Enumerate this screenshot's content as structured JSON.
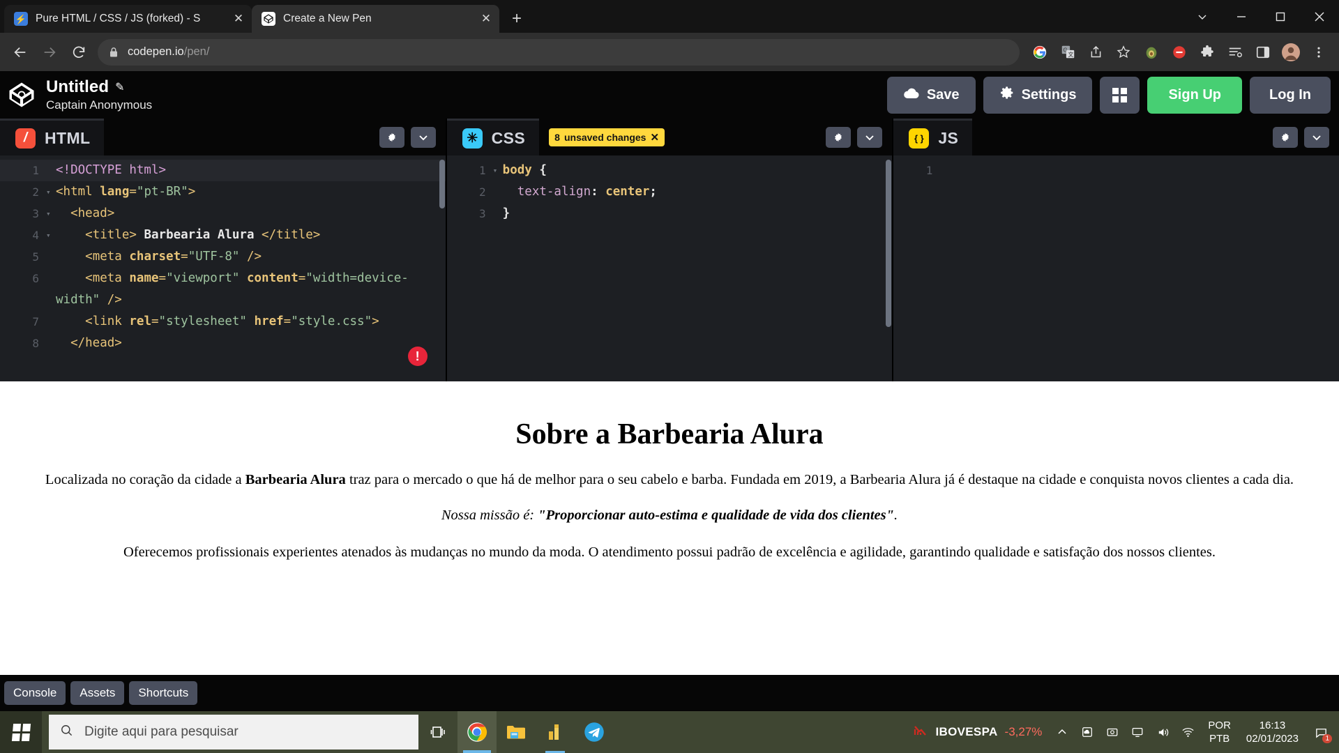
{
  "browser": {
    "tabs": [
      {
        "title": "Pure HTML / CSS / JS (forked) - S",
        "favicon": "codesandbox-bolt-icon",
        "active": false
      },
      {
        "title": "Create a New Pen",
        "favicon": "codepen-icon",
        "active": true
      }
    ],
    "new_tab_label": "+",
    "window_controls": {
      "minimize": "minimize-icon",
      "maximize": "maximize-icon",
      "close": "close-icon",
      "caret": "chevron-down-icon"
    },
    "nav": {
      "back": "back-arrow-icon",
      "forward": "forward-arrow-icon",
      "reload": "reload-icon"
    },
    "omnibox": {
      "lock": "lock-icon",
      "domain": "codepen.io",
      "path": "/pen/"
    },
    "toolbar_icons": [
      "google-icon",
      "google-translate-icon",
      "share-icon",
      "bookmark-star-icon",
      "avocado-extension-icon",
      "adblock-extension-icon",
      "puzzle-extensions-icon",
      "reading-list-icon",
      "side-panel-icon",
      "profile-avatar-icon",
      "chrome-menu-icon"
    ]
  },
  "codepen": {
    "header": {
      "logo": "codepen-logo-icon",
      "pen_title": "Untitled",
      "pencil": "pencil-icon",
      "author": "Captain Anonymous",
      "save_label": "Save",
      "save_icon": "cloud-icon",
      "settings_label": "Settings",
      "settings_icon": "gear-icon",
      "layout_icon": "layout-grid-icon",
      "signup_label": "Sign Up",
      "login_label": "Log In",
      "signup_color": "#47cf73",
      "button_color": "#4a4f5e"
    },
    "editors": [
      {
        "id": "html",
        "label": "HTML",
        "chip": "html-icon",
        "chip_color": "#f5503b",
        "badge": null,
        "settings_icon": "gear-icon",
        "chevron_icon": "chevron-down-icon",
        "error_badge": "!",
        "lines": [
          {
            "num": "1",
            "fold": "",
            "highlight": true,
            "tokens": [
              {
                "t": "doct",
                "s": "<!DOCTYPE html>"
              }
            ]
          },
          {
            "num": "2",
            "fold": "▾",
            "highlight": false,
            "tokens": [
              {
                "t": "tag",
                "s": "<html "
              },
              {
                "t": "attr",
                "s": "lang"
              },
              {
                "t": "tag",
                "s": "="
              },
              {
                "t": "str",
                "s": "\"pt-BR\""
              },
              {
                "t": "tag",
                "s": ">"
              }
            ]
          },
          {
            "num": "3",
            "fold": "▾",
            "highlight": false,
            "tokens": [
              {
                "t": "plain",
                "s": "  "
              },
              {
                "t": "tag",
                "s": "<head>"
              }
            ]
          },
          {
            "num": "4",
            "fold": "▾",
            "highlight": false,
            "tokens": [
              {
                "t": "plain",
                "s": "    "
              },
              {
                "t": "tag",
                "s": "<title>"
              },
              {
                "t": "txt",
                "s": " Barbearia Alura "
              },
              {
                "t": "tag",
                "s": "</title>"
              }
            ]
          },
          {
            "num": "5",
            "fold": "",
            "highlight": false,
            "tokens": [
              {
                "t": "plain",
                "s": "    "
              },
              {
                "t": "tag",
                "s": "<meta "
              },
              {
                "t": "attr",
                "s": "charset"
              },
              {
                "t": "tag",
                "s": "="
              },
              {
                "t": "str",
                "s": "\"UTF-8\""
              },
              {
                "t": "tag",
                "s": " />"
              }
            ]
          },
          {
            "num": "6",
            "fold": "",
            "highlight": false,
            "tokens": [
              {
                "t": "plain",
                "s": "    "
              },
              {
                "t": "tag",
                "s": "<meta "
              },
              {
                "t": "attr",
                "s": "name"
              },
              {
                "t": "tag",
                "s": "="
              },
              {
                "t": "str",
                "s": "\"viewport\""
              },
              {
                "t": "plain",
                "s": " "
              },
              {
                "t": "attr",
                "s": "content"
              },
              {
                "t": "tag",
                "s": "="
              },
              {
                "t": "str",
                "s": "\"width=device-width\""
              },
              {
                "t": "tag",
                "s": " />"
              }
            ]
          },
          {
            "num": "7",
            "fold": "",
            "highlight": false,
            "tokens": [
              {
                "t": "plain",
                "s": "    "
              },
              {
                "t": "tag",
                "s": "<link "
              },
              {
                "t": "attr",
                "s": "rel"
              },
              {
                "t": "tag",
                "s": "="
              },
              {
                "t": "str",
                "s": "\"stylesheet\""
              },
              {
                "t": "plain",
                "s": " "
              },
              {
                "t": "attr",
                "s": "href"
              },
              {
                "t": "tag",
                "s": "="
              },
              {
                "t": "str",
                "s": "\"style.css\""
              },
              {
                "t": "tag",
                "s": ">"
              }
            ]
          },
          {
            "num": "8",
            "fold": "",
            "highlight": false,
            "tokens": [
              {
                "t": "plain",
                "s": "  "
              },
              {
                "t": "tag",
                "s": "</head>"
              }
            ]
          }
        ]
      },
      {
        "id": "css",
        "label": "CSS",
        "chip": "css-icon",
        "chip_color": "#3acaf9",
        "badge": {
          "count": "8",
          "text": "unsaved changes",
          "close": "✕",
          "color": "#ffd83d"
        },
        "settings_icon": "gear-icon",
        "chevron_icon": "chevron-down-icon",
        "error_badge": null,
        "lines": [
          {
            "num": "1",
            "fold": "▾",
            "highlight": false,
            "tokens": [
              {
                "t": "sel",
                "s": "body"
              },
              {
                "t": "plain",
                "s": " "
              },
              {
                "t": "brace",
                "s": "{"
              }
            ]
          },
          {
            "num": "2",
            "fold": "",
            "highlight": false,
            "tokens": [
              {
                "t": "plain",
                "s": "  "
              },
              {
                "t": "prop",
                "s": "text-align"
              },
              {
                "t": "brace",
                "s": ":"
              },
              {
                "t": "plain",
                "s": " "
              },
              {
                "t": "val",
                "s": "center"
              },
              {
                "t": "brace",
                "s": ";"
              }
            ]
          },
          {
            "num": "3",
            "fold": "",
            "highlight": false,
            "tokens": [
              {
                "t": "brace",
                "s": "}"
              }
            ]
          }
        ]
      },
      {
        "id": "js",
        "label": "JS",
        "chip": "js-icon",
        "chip_color": "#ffd500",
        "badge": null,
        "settings_icon": "gear-icon",
        "chevron_icon": "chevron-down-icon",
        "error_badge": null,
        "lines": [
          {
            "num": "1",
            "fold": "",
            "highlight": false,
            "tokens": []
          }
        ]
      }
    ],
    "preview": {
      "heading": "Sobre a Barbearia Alura",
      "paragraph_1_pre": "Localizada no coração da cidade a ",
      "paragraph_1_bold": "Barbearia Alura",
      "paragraph_1_post": " traz para o mercado o que há de melhor para o seu cabelo e barba. Fundada em 2019, a Barbearia Alura já é destaque na cidade e conquista novos clientes a cada dia.",
      "mission_pre": "Nossa missão é: ",
      "mission_quote": "\"Proporcionar auto-estima e qualidade de vida dos clientes\"",
      "mission_post": ".",
      "paragraph_2": "Oferecemos profissionais experientes atenados às mudanças no mundo da moda. O atendimento possui padrão de excelência e agilidade, garantindo qualidade e satisfação dos nossos clientes."
    },
    "footer": {
      "console_label": "Console",
      "assets_label": "Assets",
      "shortcuts_label": "Shortcuts"
    }
  },
  "taskbar": {
    "start_icon": "windows-start-icon",
    "search_icon": "search-icon",
    "search_placeholder": "Digite aqui para pesquisar",
    "task_view_icon": "task-view-icon",
    "apps": [
      {
        "name": "chrome-taskbar-icon",
        "state": "active"
      },
      {
        "name": "file-explorer-taskbar-icon",
        "state": "idle"
      },
      {
        "name": "bar-chart-app-taskbar-icon",
        "state": "open"
      },
      {
        "name": "telegram-taskbar-icon",
        "state": "idle"
      }
    ],
    "stock": {
      "icon": "stock-down-icon",
      "name": "IBOVESPA",
      "value": "-3,27%",
      "color": "#ff6b5e"
    },
    "tray_icons": [
      "show-hidden-icons-chevron",
      "onedrive-icon",
      "screen-capture-icon",
      "monitor-icon",
      "volume-icon",
      "network-icon"
    ],
    "language": {
      "line1": "POR",
      "line2": "PTB"
    },
    "clock": {
      "time": "16:13",
      "date": "02/01/2023"
    },
    "notifications": {
      "icon": "notification-icon",
      "count": "1"
    }
  }
}
